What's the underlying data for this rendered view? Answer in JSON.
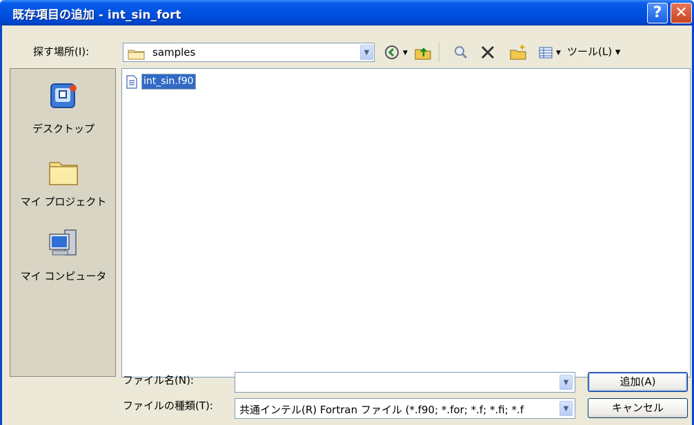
{
  "window": {
    "title": "既存項目の追加 - int_sin_fort",
    "help_glyph": "?",
    "close_glyph": "✕"
  },
  "lookin": {
    "label": "探す場所(I):",
    "value": "samples"
  },
  "toolbar": {
    "tools_label": "ツール(L) ▾"
  },
  "places": {
    "items": [
      {
        "label": "デスクトップ",
        "icon": "desktop-icon"
      },
      {
        "label": "マイ プロジェクト",
        "icon": "folder-icon"
      },
      {
        "label": "マイ コンピュータ",
        "icon": "computer-icon"
      }
    ]
  },
  "files": {
    "items": [
      {
        "name": "int_sin.f90",
        "selected": true
      }
    ]
  },
  "filename": {
    "label": "ファイル名(N):",
    "value": ""
  },
  "filetype": {
    "label": "ファイルの種類(T):",
    "value": "共通インテル(R) Fortran ファイル (*.f90; *.for; *.f; *.fi; *.f"
  },
  "buttons": {
    "add": "追加(A)",
    "cancel": "キャンセル"
  },
  "colors": {
    "titlebar": "#0055e5",
    "dialog_bg": "#ece9d8",
    "selection": "#316ac5"
  }
}
